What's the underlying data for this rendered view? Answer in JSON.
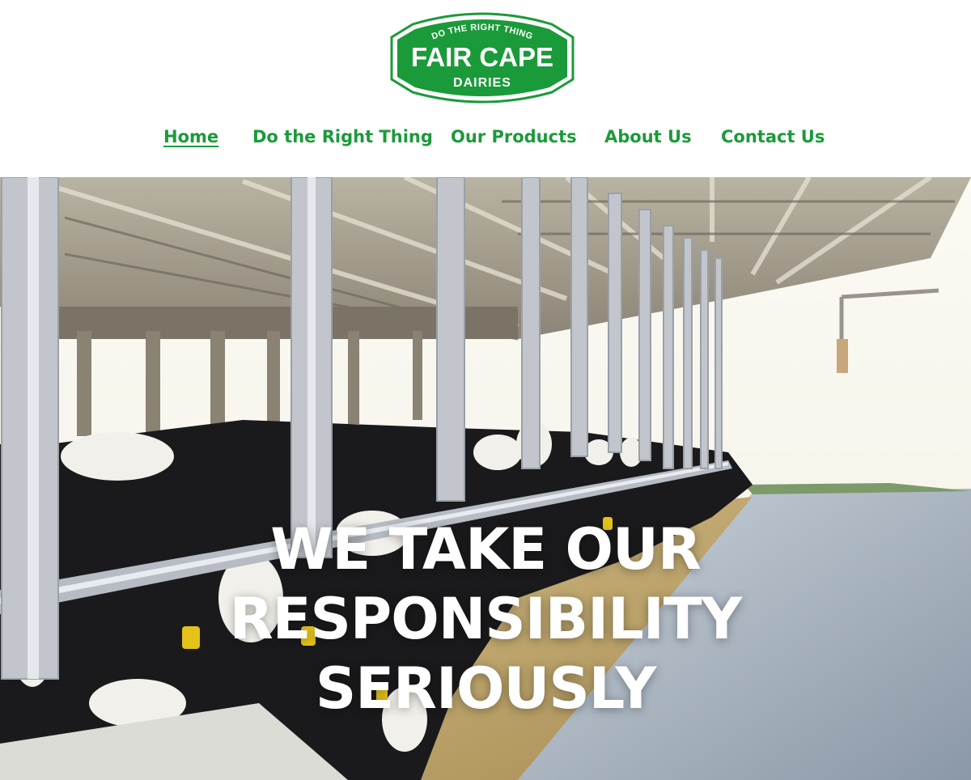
{
  "brand": {
    "tagline": "DO THE RIGHT THING",
    "name": "FAIR CAPE",
    "sub": "DAIRIES",
    "color": "#1b9a3a"
  },
  "nav": {
    "items": [
      {
        "label": "Home",
        "active": true
      },
      {
        "label": "Do the Right Thing",
        "active": false
      },
      {
        "label": "Our Products",
        "active": false
      },
      {
        "label": "About Us",
        "active": false
      },
      {
        "label": "Contact Us",
        "active": false
      }
    ]
  },
  "hero": {
    "image": "cows-feeding-in-barn",
    "headline": [
      "WE TAKE OUR",
      "RESPONSIBILITY",
      "SERIOUSLY"
    ]
  }
}
